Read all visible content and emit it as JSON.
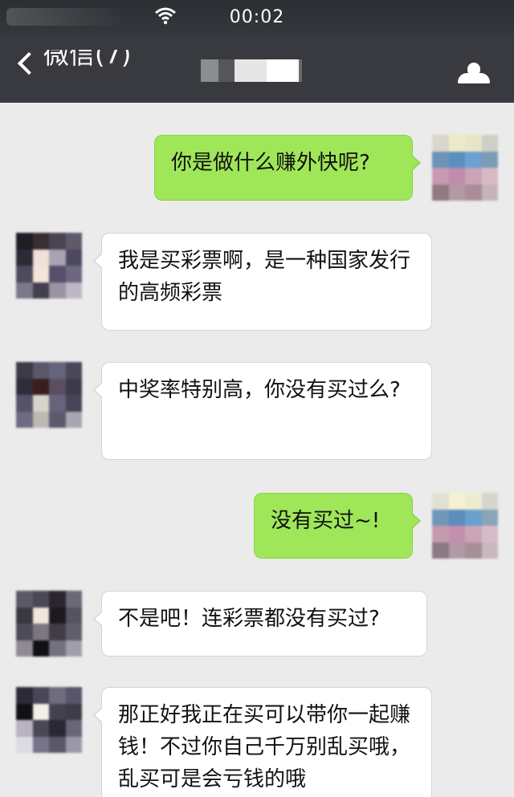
{
  "status_bar": {
    "time": "00:02",
    "wifi_icon": "wifi-icon"
  },
  "nav": {
    "back_label": "微信(7)",
    "back_icon": "chevron-left-icon",
    "profile_icon": "person-icon",
    "bar_color": "#393a3f"
  },
  "colors": {
    "incoming_bubble": "#ffffff",
    "outgoing_bubble": "#9fe658",
    "background": "#ebebeb"
  },
  "messages": [
    {
      "direction": "out",
      "text": "你是做什么赚外快呢?"
    },
    {
      "direction": "in",
      "text": "我是买彩票啊，是一种国家发行的高频彩票"
    },
    {
      "direction": "in",
      "text": "中奖率特别高，你没有买过么?"
    },
    {
      "direction": "out",
      "text": "没有买过~!"
    },
    {
      "direction": "in",
      "text": "不是吧！连彩票都没有买过?"
    },
    {
      "direction": "in",
      "text": "那正好我正在买可以带你一起赚钱！不过你自己千万别乱买哦，乱买可是会亏钱的哦"
    }
  ]
}
